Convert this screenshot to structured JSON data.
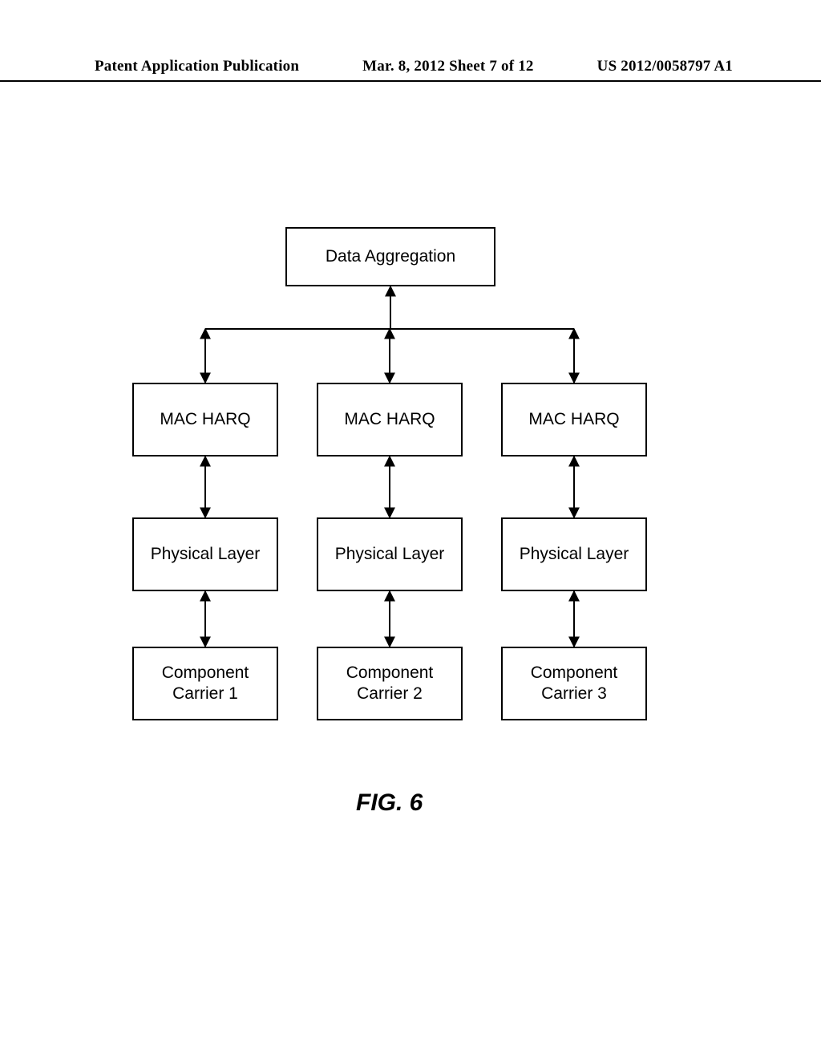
{
  "header": {
    "left": "Patent Application Publication",
    "mid": "Mar. 8, 2012  Sheet 7 of 12",
    "right": "US 2012/0058797 A1"
  },
  "diagram": {
    "top_box": "Data Aggregation",
    "columns": [
      {
        "mac": "MAC HARQ",
        "phy": "Physical Layer",
        "cc": "Component\nCarrier 1"
      },
      {
        "mac": "MAC HARQ",
        "phy": "Physical Layer",
        "cc": "Component\nCarrier 2"
      },
      {
        "mac": "MAC HARQ",
        "phy": "Physical Layer",
        "cc": "Component\nCarrier 3"
      }
    ],
    "figure_label": "FIG. 6"
  }
}
